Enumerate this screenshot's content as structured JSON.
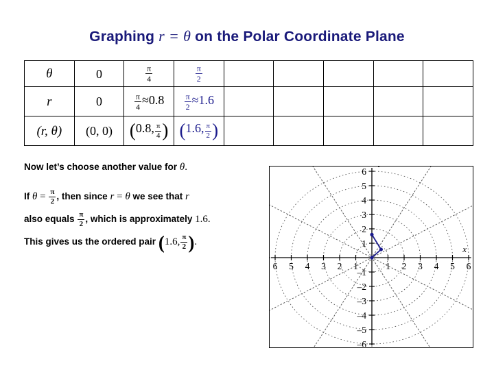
{
  "title": {
    "pre": "Graphing",
    "eq_r": "r",
    "eq_sign": "=",
    "eq_theta": "θ",
    "post": "on the Polar Coordinate Plane"
  },
  "table": {
    "row_labels": [
      "θ",
      "r",
      "(r, θ)"
    ],
    "columns": 9,
    "theta_row": {
      "label": "θ",
      "cells": [
        {
          "text": "0",
          "type": "plain"
        },
        {
          "type": "frac",
          "num": "π",
          "den": "4"
        },
        {
          "type": "frac",
          "num": "π",
          "den": "2",
          "highlight": true
        }
      ],
      "empty_cells": 5
    },
    "r_row": {
      "label": "r",
      "cells": [
        {
          "text": "0",
          "type": "plain"
        },
        {
          "type": "frac_approx",
          "num": "π",
          "den": "4",
          "approx": "≈",
          "value": "0.8"
        },
        {
          "type": "frac_approx",
          "num": "π",
          "den": "2",
          "approx": "≈",
          "value": "1.6",
          "highlight": true
        }
      ],
      "empty_cells": 5
    },
    "pair_row": {
      "label": "(r, θ)",
      "cells": [
        {
          "type": "pair_plain",
          "text": "(0, 0)"
        },
        {
          "type": "pair_frac",
          "r": "0.8",
          "num": "π",
          "den": "4"
        },
        {
          "type": "pair_frac",
          "r": "1.6",
          "num": "π",
          "den": "2",
          "highlight": true
        }
      ],
      "empty_cells": 5
    }
  },
  "body": {
    "line1_a": "Now let’s choose another value for",
    "line1_theta": "θ",
    "line1_b": ".",
    "line2_a": "If",
    "line2_theta": "θ",
    "line2_eq": "=",
    "line2_frac_num": "π",
    "line2_frac_den": "2",
    "line2_b": ", then since",
    "line2_r": "r",
    "line2_eq2": "=",
    "line2_theta2": "θ",
    "line2_c": "we see that",
    "line2_r2": "r",
    "line3_a": "also equals",
    "line3_frac_num": "π",
    "line3_frac_den": "2",
    "line3_b": ", which is approximately",
    "line3_val": "1.6",
    "line3_c": ".",
    "line4_a": "This gives us the ordered pair",
    "line4_r": "1.6",
    "line4_comma": ",",
    "line4_num": "π",
    "line4_den": "2",
    "line4_b": "."
  },
  "plot": {
    "x_axis_label": "x",
    "y_axis_label": "y",
    "x_ticks_left": [
      "6",
      "5",
      "4",
      "3",
      "2",
      "1"
    ],
    "x_ticks_right": [
      "1",
      "2",
      "3",
      "4",
      "5",
      "6"
    ],
    "y_ticks_up": [
      "1",
      "2",
      "3",
      "4",
      "5",
      "6"
    ],
    "y_ticks_down": [
      "–1",
      "–2",
      "–3",
      "–4",
      "–5",
      "–6"
    ],
    "grid_color": "#555555",
    "point_color": "#1a1a8c",
    "axis_color": "#000000",
    "radial_rings": [
      1,
      2,
      3,
      4,
      5,
      6
    ],
    "spoke_count": 12
  },
  "chart_data": {
    "type": "scatter",
    "title": "Graphing r = θ on the Polar Coordinate Plane",
    "xlabel": "x",
    "ylabel": "y",
    "xlim": [
      -6.5,
      6.5
    ],
    "ylim": [
      -6.5,
      6.5
    ],
    "grid": "polar-dotted",
    "legend": "none",
    "polar_points": [
      {
        "theta": 0,
        "theta_label": "0",
        "r": 0,
        "r_label": "0",
        "x": 0,
        "y": 0
      },
      {
        "theta": 0.785,
        "theta_label": "π/4",
        "r": 0.8,
        "r_label": "0.8",
        "x": 0.57,
        "y": 0.57
      },
      {
        "theta": 1.571,
        "theta_label": "π/2",
        "r": 1.6,
        "r_label": "1.6",
        "x": 0,
        "y": 1.6
      }
    ]
  }
}
